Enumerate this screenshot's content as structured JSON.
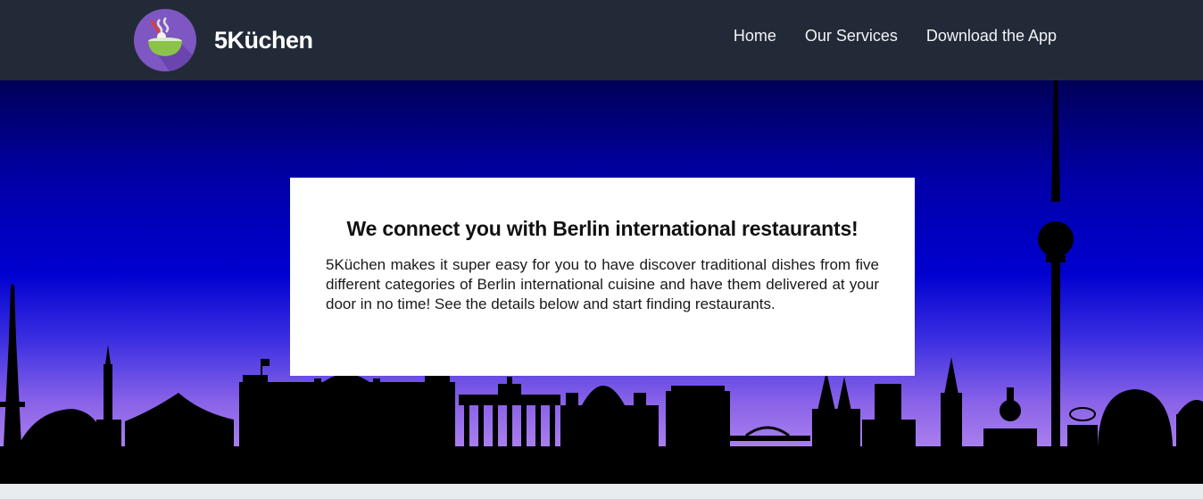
{
  "nav": {
    "brand": "5Küchen",
    "links": [
      "Home",
      "Our Services",
      "Download the App"
    ]
  },
  "hero": {
    "title": "We connect you with Berlin international restaurants!",
    "text": "5Küchen makes it super easy for you to have discover traditional dishes from five different categories of Berlin international cuisine and have them delivered at your door in no time! See the details below and start finding restaurants."
  },
  "icons": {
    "logo": "steaming-bowl-logo-icon"
  },
  "colors": {
    "navbar": "#222a37",
    "logo_circle": "#7e57c2",
    "bowl": "#8bc34a",
    "sky_top": "#000058",
    "sky_mid": "#0000d0",
    "sky_bottom": "#b58af0",
    "silhouette": "#000000"
  }
}
